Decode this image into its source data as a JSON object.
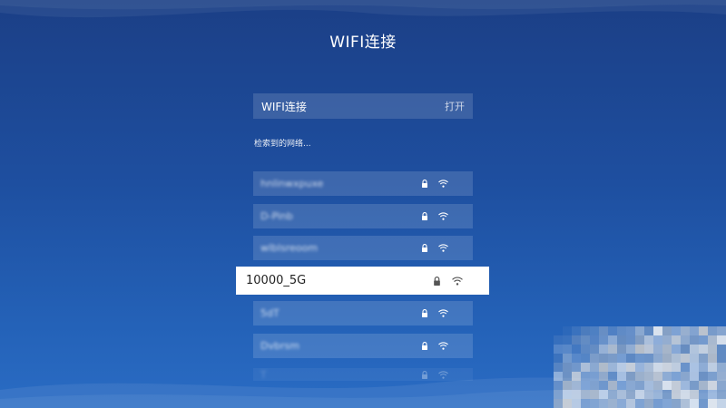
{
  "page": {
    "title": "WIFI连接"
  },
  "wifi_toggle": {
    "label": "WIFI连接",
    "status": "打开"
  },
  "networks_section": {
    "label": "检索到的网络..."
  },
  "networks": [
    {
      "ssid": "hnlinwxpuxe",
      "secured": true,
      "selected": false
    },
    {
      "ssid": "D-Pinb",
      "secured": true,
      "selected": false
    },
    {
      "ssid": "wlblsreoom",
      "secured": true,
      "selected": false
    },
    {
      "ssid": "10000_5G",
      "secured": true,
      "selected": true
    },
    {
      "ssid": "5dT",
      "secured": true,
      "selected": false
    },
    {
      "ssid": "Dvbrsm",
      "secured": true,
      "selected": false
    },
    {
      "ssid": "T",
      "secured": true,
      "selected": false
    }
  ],
  "icons": {
    "lock": "lock-icon",
    "signal": "wifi-signal-icon"
  },
  "colors": {
    "accent_bg": "#1e4fa0",
    "selected_bg": "#ffffff",
    "selected_text": "#222222"
  }
}
